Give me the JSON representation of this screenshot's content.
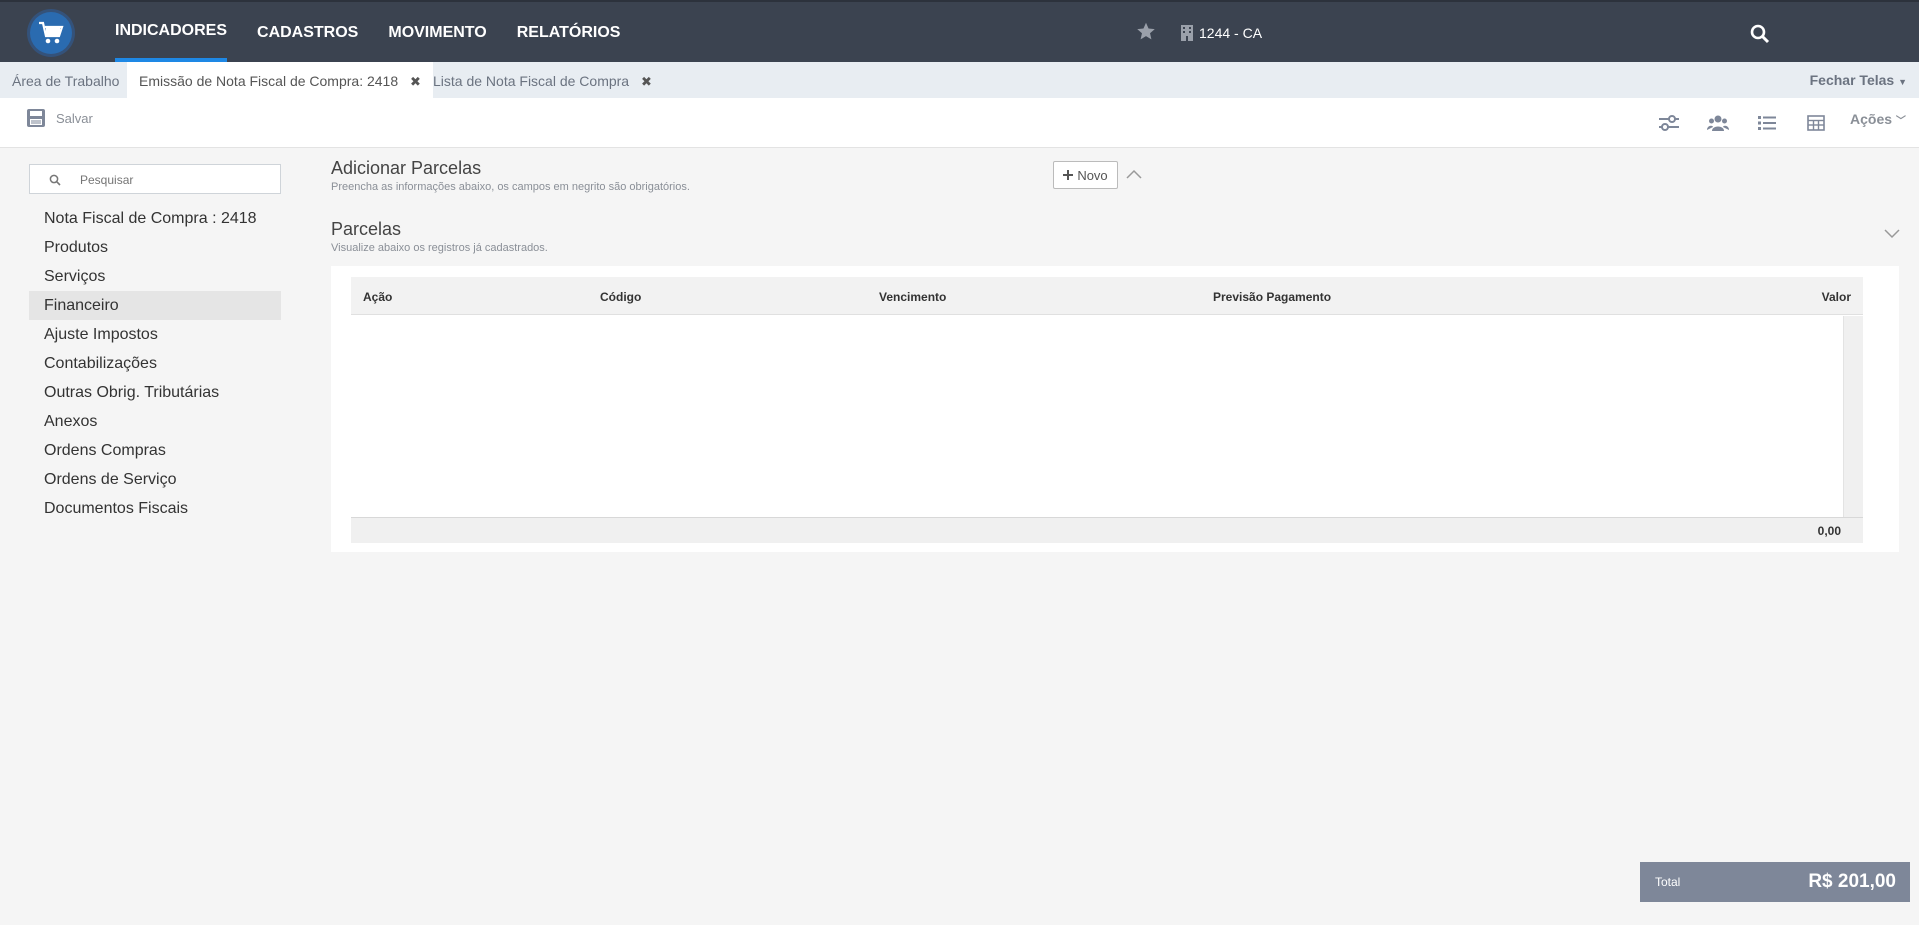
{
  "nav": {
    "items": [
      "INDICADORES",
      "CADASTROS",
      "MOVIMENTO",
      "RELATÓRIOS"
    ],
    "company": "1244 - CA"
  },
  "tabs": {
    "items": [
      {
        "label": "Área de Trabalho"
      },
      {
        "label": "Emissão de Nota Fiscal de Compra: 2418"
      },
      {
        "label": "Lista de Nota Fiscal de Compra"
      }
    ],
    "close_all": "Fechar Telas"
  },
  "toolbar": {
    "save_label": "Salvar",
    "actions_label": "Ações"
  },
  "sidebar": {
    "search_placeholder": "Pesquisar",
    "items": [
      {
        "label": "Nota Fiscal de Compra : 2418"
      },
      {
        "label": "Produtos"
      },
      {
        "label": "Serviços"
      },
      {
        "label": "Financeiro"
      },
      {
        "label": "Ajuste Impostos"
      },
      {
        "label": "Contabilizações"
      },
      {
        "label": "Outras Obrig. Tributárias"
      },
      {
        "label": "Anexos"
      },
      {
        "label": "Ordens Compras"
      },
      {
        "label": "Ordens de Serviço"
      },
      {
        "label": "Documentos Fiscais"
      }
    ],
    "active_index": 3
  },
  "add_section": {
    "title": "Adicionar Parcelas",
    "subtitle": "Preencha as informações abaixo, os campos em negrito são obrigatórios.",
    "new_button": "Novo"
  },
  "list_section": {
    "title": "Parcelas",
    "subtitle": "Visualize abaixo os registros já cadastrados."
  },
  "grid": {
    "columns": [
      "Ação",
      "Código",
      "Vencimento",
      "Previsão Pagamento",
      "Valor"
    ],
    "rows": [],
    "footer_total": "0,00"
  },
  "total": {
    "label": "Total",
    "value": "R$ 201,00"
  },
  "colors": {
    "topbar": "#3b4350",
    "accent": "#1e88e5",
    "total_bg": "#7e8799"
  }
}
